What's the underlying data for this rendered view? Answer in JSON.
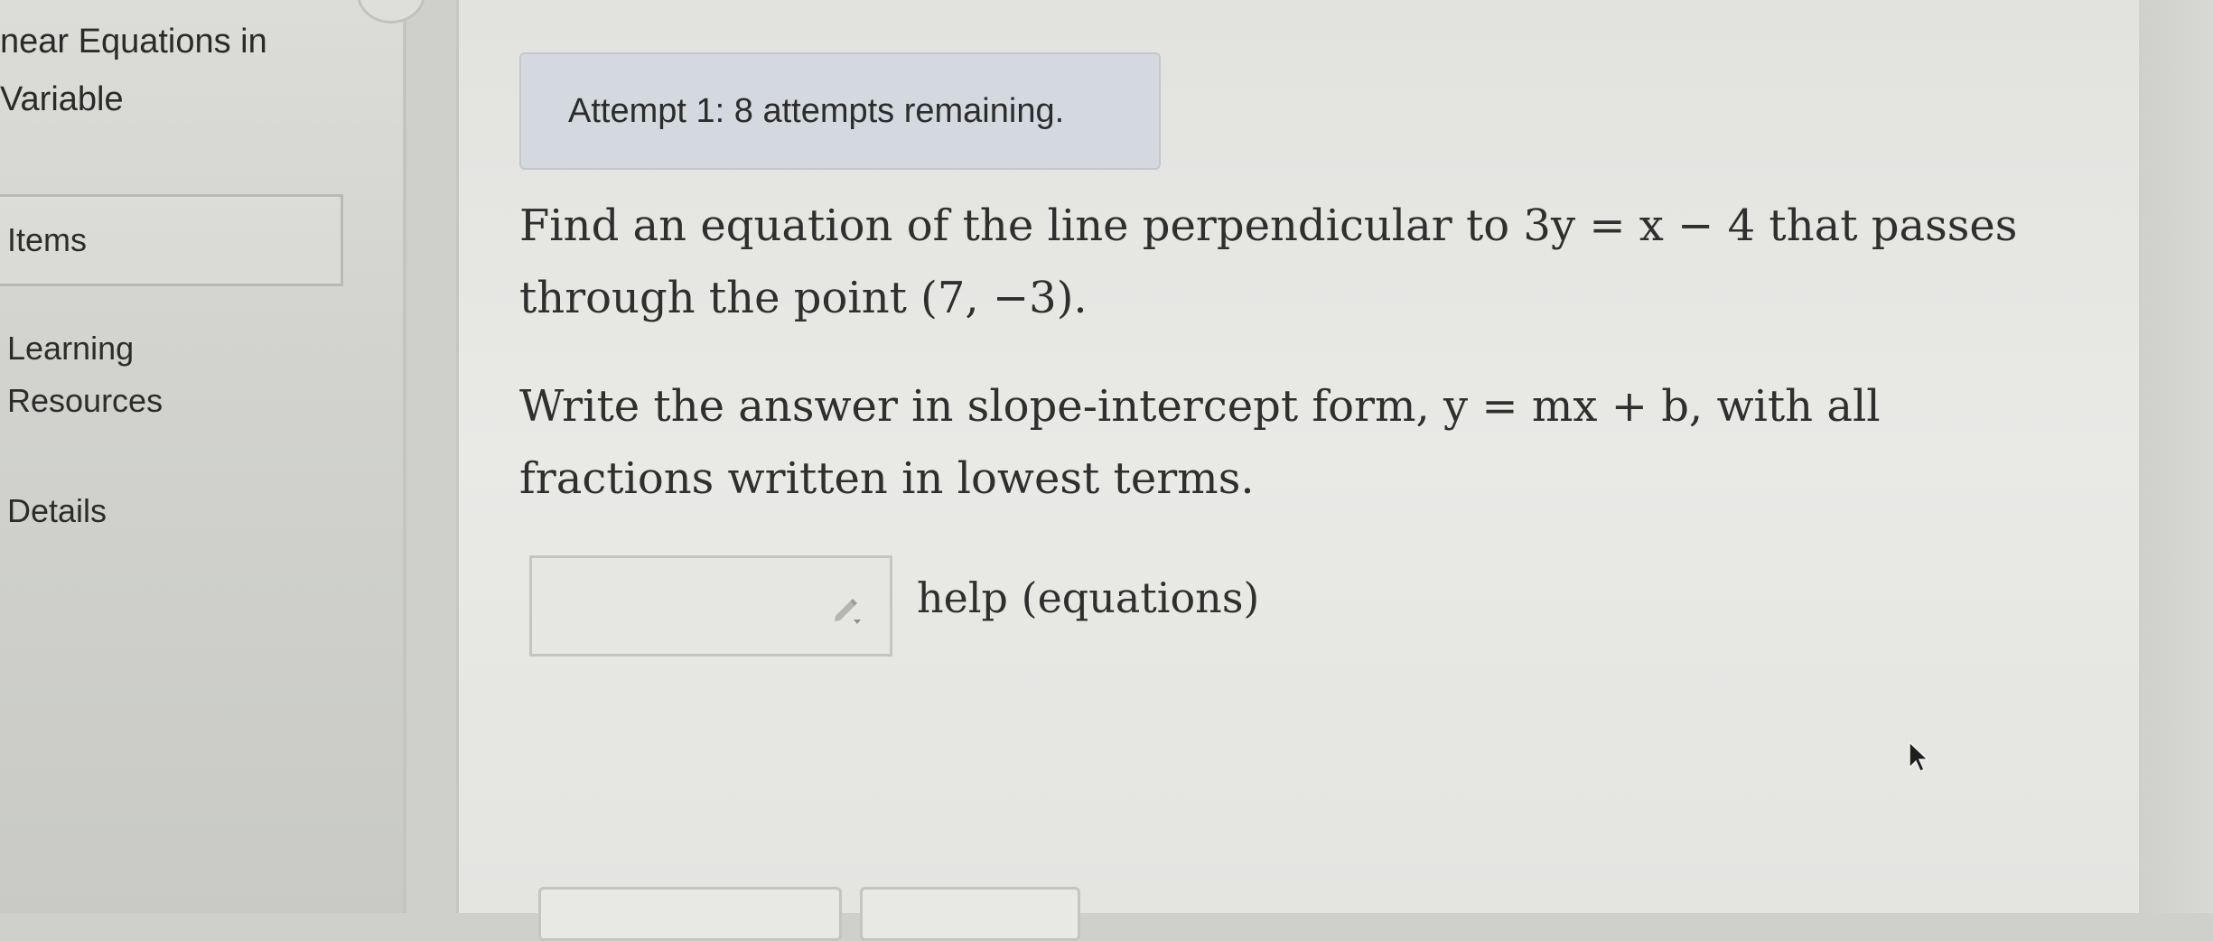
{
  "sidebar": {
    "title": "near Equations in\nVariable",
    "items": [
      {
        "label": "Items"
      },
      {
        "label": "Learning\nResources"
      },
      {
        "label": "Details"
      }
    ]
  },
  "main": {
    "attempt_text": "Attempt 1: 8 attempts remaining.",
    "question_line1": "Find an equation of the line perpendicular to 3y = x − 4 that passes through the point (7, −3).",
    "question_line2": "Write the answer in slope-intercept form, y = mx + b, with all fractions written in lowest terms.",
    "answer_value": "",
    "help_label": "help (equations)"
  },
  "icons": {
    "pencil": "pencil-icon",
    "cursor": "mouse-cursor-icon"
  }
}
